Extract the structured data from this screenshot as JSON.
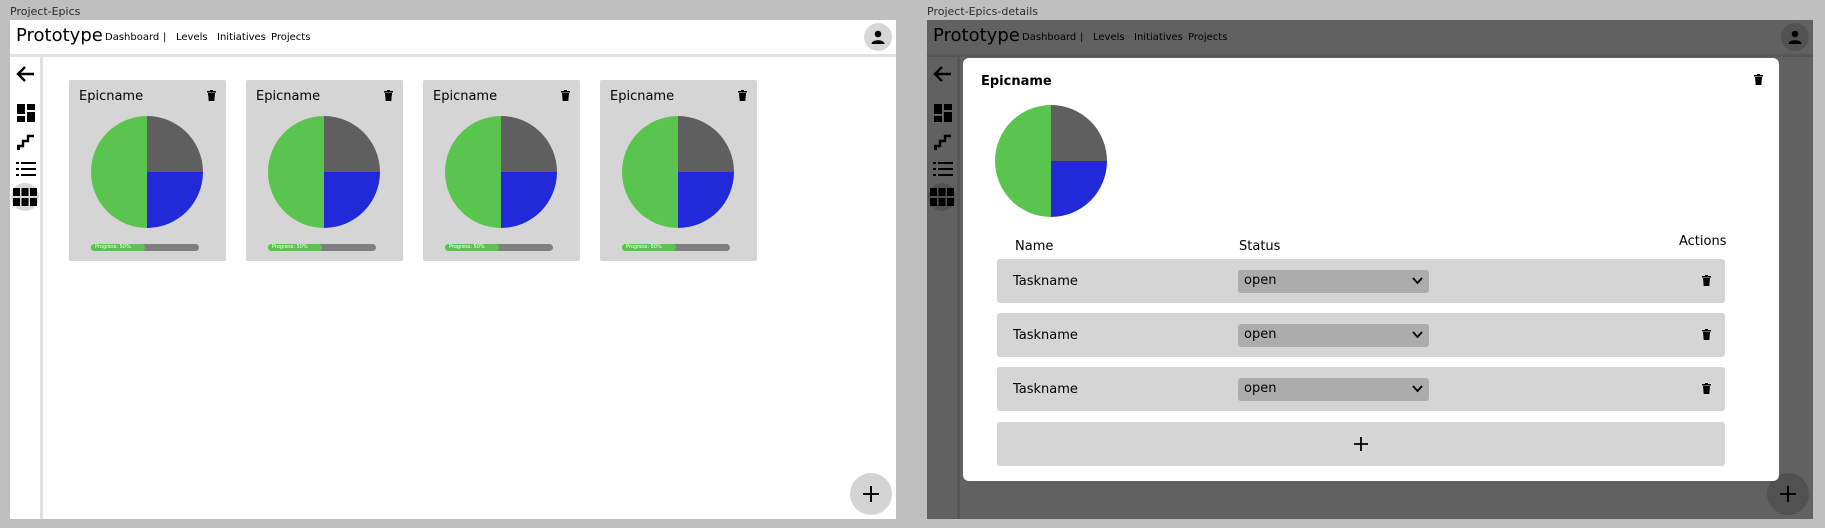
{
  "frames": {
    "left_label": "Project-Epics",
    "right_label": "Project-Epics-details"
  },
  "app": {
    "title": "Prototype",
    "nav": {
      "dashboard": "Dashboard",
      "separator": "|",
      "levels": "Levels",
      "initiatives": "Initiatives",
      "projects": "Projects"
    }
  },
  "sidebar": {
    "icons": [
      "back-arrow-icon",
      "dashboard-icon",
      "levels-icon",
      "list-icon",
      "grid-icon"
    ],
    "active": "grid-icon"
  },
  "epics": [
    {
      "name": "Epicname",
      "progress_label": "Progress: 50%",
      "progress": 0.5
    },
    {
      "name": "Epicname",
      "progress_label": "Progress: 50%",
      "progress": 0.5
    },
    {
      "name": "Epicname",
      "progress_label": "Progress: 50%",
      "progress": 0.5
    },
    {
      "name": "Epicname",
      "progress_label": "Progress: 50%",
      "progress": 0.5
    }
  ],
  "pie": {
    "slices": [
      {
        "name": "green",
        "value": 50,
        "color": "#5ac54e"
      },
      {
        "name": "gray",
        "value": 25,
        "color": "#5f5f5f"
      },
      {
        "name": "blue",
        "value": 25,
        "color": "#2129d8"
      }
    ]
  },
  "details": {
    "title": "Epicname",
    "columns": {
      "name": "Name",
      "status": "Status",
      "actions": "Actions"
    },
    "tasks": [
      {
        "name": "Taskname",
        "status": "open"
      },
      {
        "name": "Taskname",
        "status": "open"
      },
      {
        "name": "Taskname",
        "status": "open"
      }
    ],
    "add_icon": "plus-icon"
  },
  "colors": {
    "canvas": "#bfbfbf",
    "card": "#d5d5d5",
    "progress_track": "#7f7f7f",
    "progress_fill": "#5ac54e",
    "select": "#acacac",
    "overlay": "rgba(0,0,0,0.62)"
  },
  "icons": {
    "card_action": "trash-icon",
    "avatar": "user-icon",
    "fab": "plus-icon",
    "select": "chevron-down-icon"
  }
}
